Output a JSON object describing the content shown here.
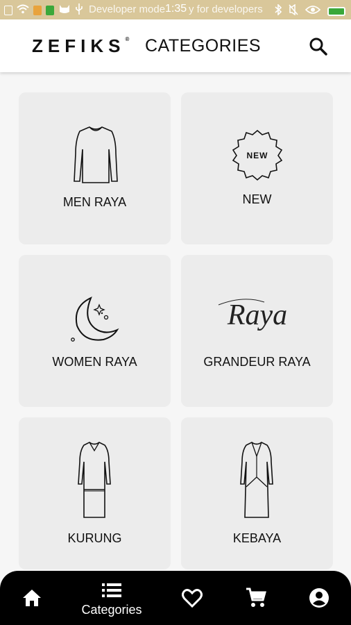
{
  "status_bar": {
    "developer_text": "Developer mode",
    "time": "1:35",
    "developer_suffix": "y for developers"
  },
  "header": {
    "brand": "ZEFIKS",
    "brand_mark": "®",
    "title": "CATEGORIES"
  },
  "categories": [
    {
      "label": "MEN RAYA",
      "icon": "shirt-icon"
    },
    {
      "label": "NEW",
      "icon": "new-badge-icon",
      "badge_text": "NEW"
    },
    {
      "label": "WOMEN RAYA",
      "icon": "crescent-moon-icon"
    },
    {
      "label": "GRANDEUR RAYA",
      "icon": "raya-script-icon",
      "script_text": "Raya"
    },
    {
      "label": "KURUNG",
      "icon": "kurung-dress-icon"
    },
    {
      "label": "KEBAYA",
      "icon": "kebaya-dress-icon"
    }
  ],
  "bottom_nav": {
    "items": [
      {
        "name": "home",
        "icon": "home-icon",
        "label": ""
      },
      {
        "name": "categories",
        "icon": "list-icon",
        "label": "Categories"
      },
      {
        "name": "wishlist",
        "icon": "heart-icon",
        "label": ""
      },
      {
        "name": "cart",
        "icon": "cart-icon",
        "label": ""
      },
      {
        "name": "account",
        "icon": "account-icon",
        "label": ""
      }
    ]
  }
}
